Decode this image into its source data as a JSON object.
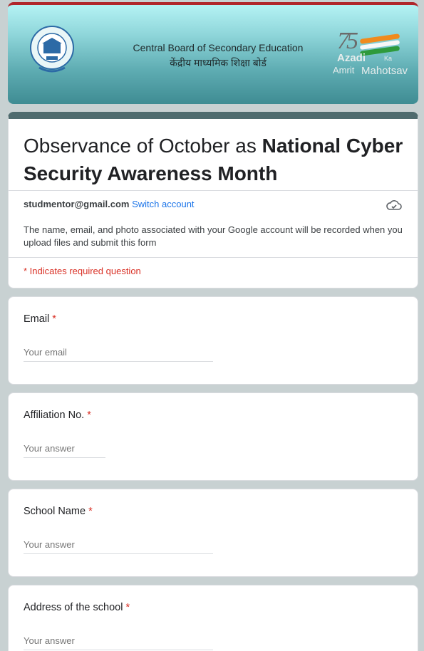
{
  "banner": {
    "title_en": "Central Board of Secondary Education",
    "title_hi": "केंद्रीय माध्यमिक शिक्षा बोर्ड",
    "logo_right_number": "75",
    "logo_right_azadi": "Azadi",
    "logo_right_ka": "Ka",
    "logo_right_amrit": "Amrit",
    "logo_right_mahotsav": "Mahotsav"
  },
  "form": {
    "title_normal": "Observance of October as ",
    "title_bold": "National Cyber Security Awareness Month",
    "account_email": "studmentor@gmail.com",
    "switch_account": "Switch account",
    "notice": "The name, email, and photo associated with your Google account will be recorded when you upload files and submit this form",
    "required_note": "* Indicates required question"
  },
  "questions": [
    {
      "label": "Email",
      "star": "*",
      "placeholder": "Your email"
    },
    {
      "label": "Affiliation No.",
      "star": "*",
      "placeholder": "Your answer"
    },
    {
      "label": "School Name",
      "star": "*",
      "placeholder": "Your answer"
    },
    {
      "label": "Address of the school",
      "star": "*",
      "placeholder": "Your answer"
    }
  ],
  "colors": {
    "accent_bar": "#4f6b6e",
    "required": "#d93025",
    "link": "#1a73e8"
  }
}
